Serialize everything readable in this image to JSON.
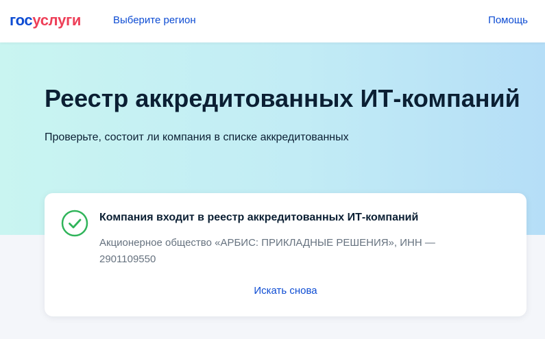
{
  "header": {
    "logo": {
      "part1": "гос",
      "part2": "услуги"
    },
    "region_link": "Выберите регион",
    "help_link": "Помощь"
  },
  "hero": {
    "title": "Реестр аккредитованных ИТ-компаний",
    "subtitle": "Проверьте, состоит ли компания в списке аккредитованных"
  },
  "result": {
    "status_icon": "check-circle-icon",
    "title": "Компания входит в реестр аккредитованных ИТ-компаний",
    "description": "Акционерное общество «АРБИС: ПРИКЛАДНЫЕ РЕШЕНИЯ», ИНН — 2901109550",
    "search_again": "Искать снова"
  },
  "colors": {
    "brand_blue": "#0d4cd3",
    "brand_red": "#ee3f58",
    "success_green": "#30b45a",
    "text_dark": "#0b1f33",
    "text_muted": "#66727f"
  }
}
